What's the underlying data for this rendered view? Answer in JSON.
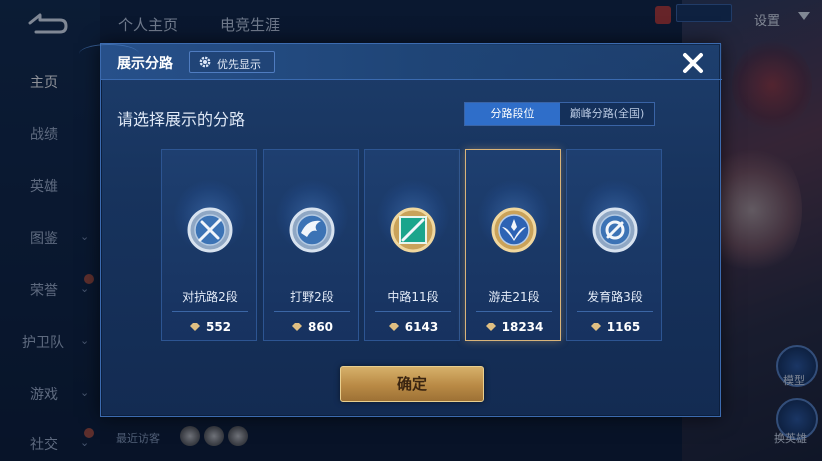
{
  "background": {
    "back_icon": "back-arrow-icon",
    "sidebar": [
      {
        "label": "主页",
        "active": true,
        "has_chevron": false
      },
      {
        "label": "战绩",
        "active": false,
        "has_chevron": false
      },
      {
        "label": "英雄",
        "active": false,
        "has_chevron": false
      },
      {
        "label": "图鉴",
        "active": false,
        "has_chevron": true
      },
      {
        "label": "荣誉",
        "active": false,
        "has_chevron": true
      },
      {
        "label": "护卫队",
        "active": false,
        "has_chevron": true
      },
      {
        "label": "游戏",
        "active": false,
        "has_chevron": true
      },
      {
        "label": "社交",
        "active": false,
        "has_chevron": true
      }
    ],
    "top_tabs": [
      "个人主页",
      "电竞生涯"
    ],
    "settings_label": "设置",
    "recent_visitors_label": "最近访客",
    "fab_labels": [
      "模型",
      "换英雄"
    ]
  },
  "dialog": {
    "title": "展示分路",
    "priority_button": "优先显示",
    "subtitle": "请选择展示的分路",
    "segments": [
      {
        "label": "分路段位",
        "active": true
      },
      {
        "label": "巅峰分路(全国)",
        "active": false
      }
    ],
    "cards": [
      {
        "name": "对抗路2段",
        "score": "552",
        "icon": "clash-lane-badge-icon",
        "selected": false
      },
      {
        "name": "打野2段",
        "score": "860",
        "icon": "jungle-badge-icon",
        "selected": false
      },
      {
        "name": "中路11段",
        "score": "6143",
        "icon": "mid-lane-badge-icon",
        "selected": false
      },
      {
        "name": "游走21段",
        "score": "18234",
        "icon": "roam-badge-icon",
        "selected": true
      },
      {
        "name": "发育路3段",
        "score": "1165",
        "icon": "farm-lane-badge-icon",
        "selected": false
      }
    ],
    "confirm_label": "确定",
    "close_icon": "close-icon"
  },
  "colors": {
    "accent_gold": "#d9b47a",
    "active_blue": "#2f6ec9",
    "panel_blue": "#1a3866"
  }
}
